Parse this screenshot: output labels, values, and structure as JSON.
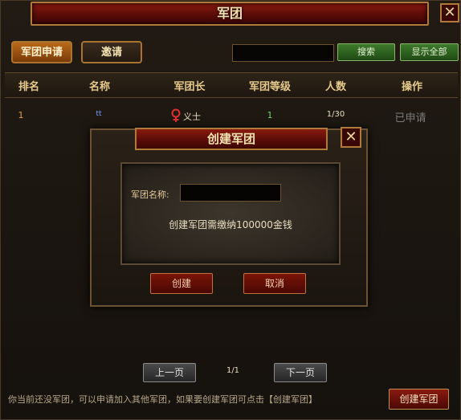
{
  "window": {
    "title": "军团",
    "close_glyph": "✕"
  },
  "tabs": {
    "apply": "军团申请",
    "invite": "邀请"
  },
  "search": {
    "button": "搜索",
    "show_all": "显示全部"
  },
  "table": {
    "headers": [
      "排名",
      "名称",
      "军团长",
      "军团等级",
      "人数",
      "操作"
    ],
    "rows": [
      {
        "rank": "1",
        "name": "tt",
        "leader": "义士",
        "level": "1",
        "members": "1/30",
        "action": "已申请"
      }
    ]
  },
  "dialog": {
    "title": "创建军团",
    "close_glyph": "✕",
    "name_label": "军团名称:",
    "cost_text": "创建军团需缴纳100000金钱",
    "confirm": "创建",
    "cancel": "取消"
  },
  "footer": {
    "prev": "上一页",
    "page": "1/1",
    "next": "下一页",
    "hint": "你当前还没军团，可以申请加入其他军团，如果要创建军团可点击【创建军团】",
    "create_guild": "创建军团"
  },
  "colors": {
    "rank": "#e0a050",
    "name": "#7aa0ff",
    "level": "#6ad36a",
    "gender_female": "#e03030",
    "applied": "#7a7a7a"
  }
}
